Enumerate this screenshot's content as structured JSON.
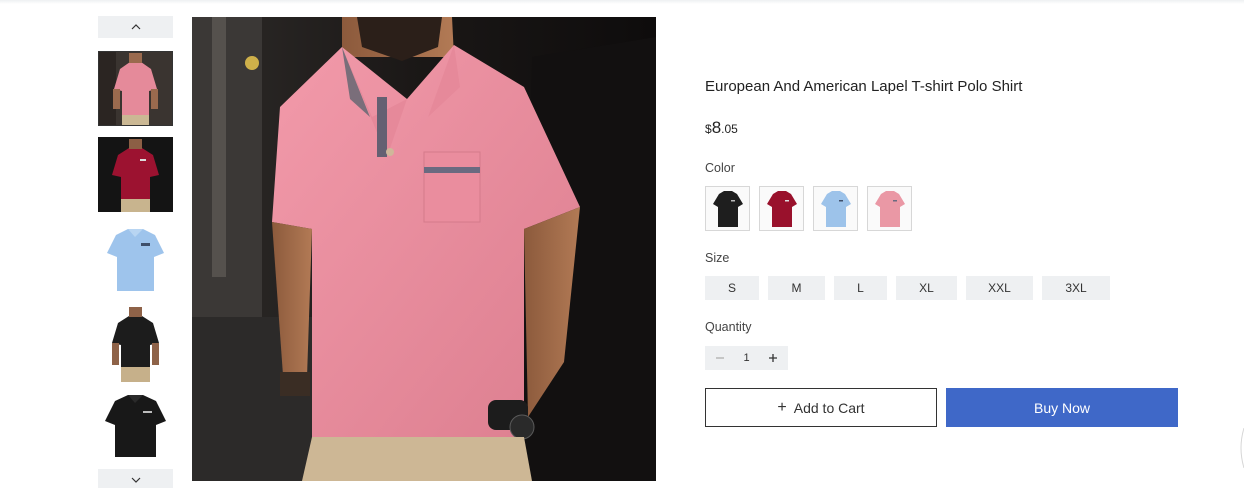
{
  "product": {
    "title": "European And American Lapel T-shirt Polo Shirt",
    "price": {
      "currency": "$",
      "integer": "8",
      "decimal": ".05"
    }
  },
  "gallery": {
    "thumbnails": [
      {
        "color": "pink",
        "hex": "#e58a9a",
        "selected": true
      },
      {
        "color": "burgundy",
        "hex": "#9c1230"
      },
      {
        "color": "light-blue",
        "hex": "#9ec4ec"
      },
      {
        "color": "black",
        "hex": "#1c1c1c"
      },
      {
        "color": "black",
        "hex": "#181818"
      }
    ]
  },
  "options": {
    "color_label": "Color",
    "colors": [
      {
        "name": "black",
        "hex": "#1e1e1e"
      },
      {
        "name": "burgundy",
        "hex": "#99112c"
      },
      {
        "name": "light-blue",
        "hex": "#9dc3ea"
      },
      {
        "name": "pink",
        "hex": "#ea98a5"
      }
    ],
    "size_label": "Size",
    "sizes": [
      "S",
      "M",
      "L",
      "XL",
      "XXL",
      "3XL"
    ],
    "quantity_label": "Quantity",
    "quantity": "1"
  },
  "actions": {
    "add_to_cart_icon": "+",
    "add_to_cart": "Add to Cart",
    "buy_now": "Buy Now"
  },
  "colors": {
    "accent": "#3f68c8",
    "chip_bg": "#eef0f2",
    "border_dark": "#333333"
  }
}
